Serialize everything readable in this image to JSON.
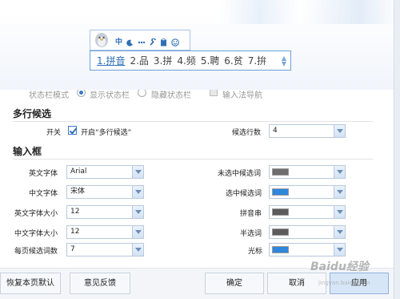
{
  "ime": {
    "toolbar_icons": [
      "中",
      "moon-icon",
      "dots-icon",
      "wrench-icon",
      "clipboard-icon",
      "smile-icon"
    ],
    "candidates": [
      "1.拼音",
      "2.品",
      "3.拼",
      "4.频",
      "5.聘",
      "6.贫",
      "7.拚"
    ]
  },
  "cut_row": {
    "label": "状态栏模式",
    "option1": "显示状态栏",
    "option2": "隐藏状态栏",
    "option3": "输入法导航"
  },
  "multi_candidate": {
    "title": "多行候选",
    "switch_label": "开关",
    "checkbox_label": "开启“多行候选”",
    "rows_label": "候选行数",
    "rows_value": "4"
  },
  "input_box": {
    "title": "输入框",
    "left": [
      {
        "label": "英文字体",
        "value": "Arial"
      },
      {
        "label": "中文字体",
        "value": "宋体"
      },
      {
        "label": "英文字体大小",
        "value": "12"
      },
      {
        "label": "中文字体大小",
        "value": "12"
      },
      {
        "label": "每页候选词数",
        "value": "7"
      }
    ],
    "right": [
      {
        "label": "未选中候选词",
        "color": "#6e6e6e"
      },
      {
        "label": "选中候选词",
        "color": "#2f86dd"
      },
      {
        "label": "拼音串",
        "color": "#5c5c5c"
      },
      {
        "label": "半选词",
        "color": "#5c5c5c"
      },
      {
        "label": "光标",
        "color": "#2f86dd"
      }
    ]
  },
  "buttons": {
    "restore": "恢复本页默认",
    "feedback": "意见反馈",
    "ok": "确定",
    "cancel": "取消",
    "apply": "应用"
  },
  "watermark": {
    "brand": "Baidu经验",
    "site": "jingyan.baidu.com"
  }
}
